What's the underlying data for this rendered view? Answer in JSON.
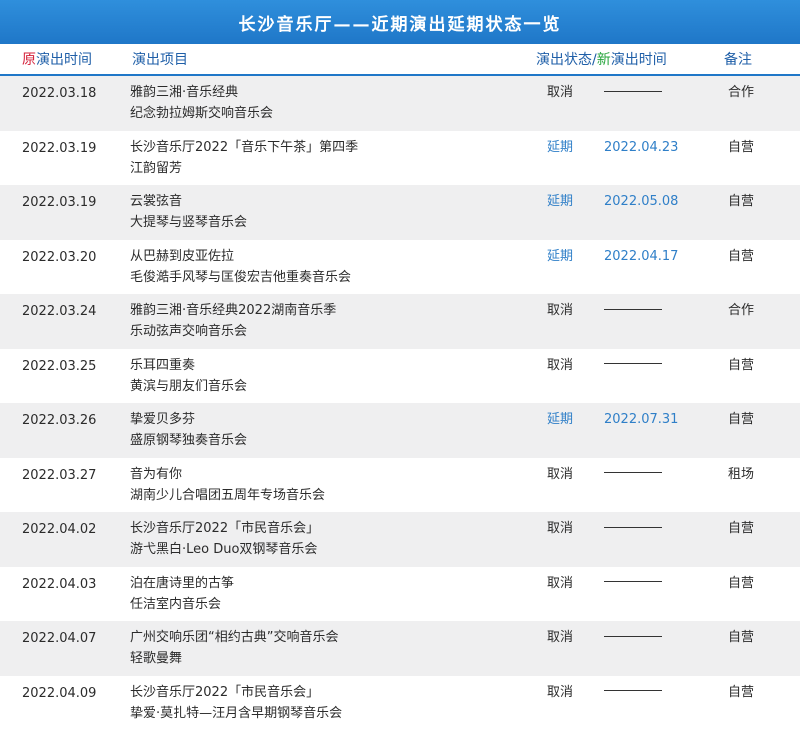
{
  "title": "长沙音乐厅——近期演出延期状态一览",
  "header": {
    "date_prefix": "原",
    "date_label": "演出时间",
    "program_label": "演出项目",
    "status_label": "演出状态/",
    "new_prefix": "新",
    "new_label": "演出时间",
    "note_label": "备注"
  },
  "rows": [
    {
      "date": "2022.03.18",
      "line1": "雅韵三湘·音乐经典",
      "line2": "纪念勃拉姆斯交响音乐会",
      "status": "取消",
      "new_date": "",
      "note": "合作"
    },
    {
      "date": "2022.03.19",
      "line1": "长沙音乐厅2022「音乐下午茶」第四季",
      "line2": "江韵留芳",
      "status": "延期",
      "new_date": "2022.04.23",
      "note": "自营"
    },
    {
      "date": "2022.03.19",
      "line1": "云裳弦音",
      "line2": "大提琴与竖琴音乐会",
      "status": "延期",
      "new_date": "2022.05.08",
      "note": "自营"
    },
    {
      "date": "2022.03.20",
      "line1": "从巴赫到皮亚佐拉",
      "line2": "毛俊澔手风琴与匡俊宏吉他重奏音乐会",
      "status": "延期",
      "new_date": "2022.04.17",
      "note": "自营"
    },
    {
      "date": "2022.03.24",
      "line1": "雅韵三湘·音乐经典2022湖南音乐季",
      "line2": "乐动弦声交响音乐会",
      "status": "取消",
      "new_date": "",
      "note": "合作"
    },
    {
      "date": "2022.03.25",
      "line1": "乐耳四重奏",
      "line2": "黄滨与朋友们音乐会",
      "status": "取消",
      "new_date": "",
      "note": "自营"
    },
    {
      "date": "2022.03.26",
      "line1": "挚爱贝多芬",
      "line2": "盛原钢琴独奏音乐会",
      "status": "延期",
      "new_date": "2022.07.31",
      "note": "自营"
    },
    {
      "date": "2022.03.27",
      "line1": "音为有你",
      "line2": "湖南少儿合唱团五周年专场音乐会",
      "status": "取消",
      "new_date": "",
      "note": "租场"
    },
    {
      "date": "2022.04.02",
      "line1": "长沙音乐厅2022「市民音乐会」",
      "line2": "游弋黑白·Leo Duo双钢琴音乐会",
      "status": "取消",
      "new_date": "",
      "note": "自营"
    },
    {
      "date": "2022.04.03",
      "line1": "泊在唐诗里的古筝",
      "line2": "任洁室内音乐会",
      "status": "取消",
      "new_date": "",
      "note": "自营"
    },
    {
      "date": "2022.04.07",
      "line1": "广州交响乐团“相约古典”交响音乐会",
      "line2": "轻歌曼舞",
      "status": "取消",
      "new_date": "",
      "note": "自营"
    },
    {
      "date": "2022.04.09",
      "line1": "长沙音乐厅2022「市民音乐会」",
      "line2": "挚爱·莫扎特—汪月含早期钢琴音乐会",
      "status": "取消",
      "new_date": "",
      "note": "自营"
    }
  ]
}
